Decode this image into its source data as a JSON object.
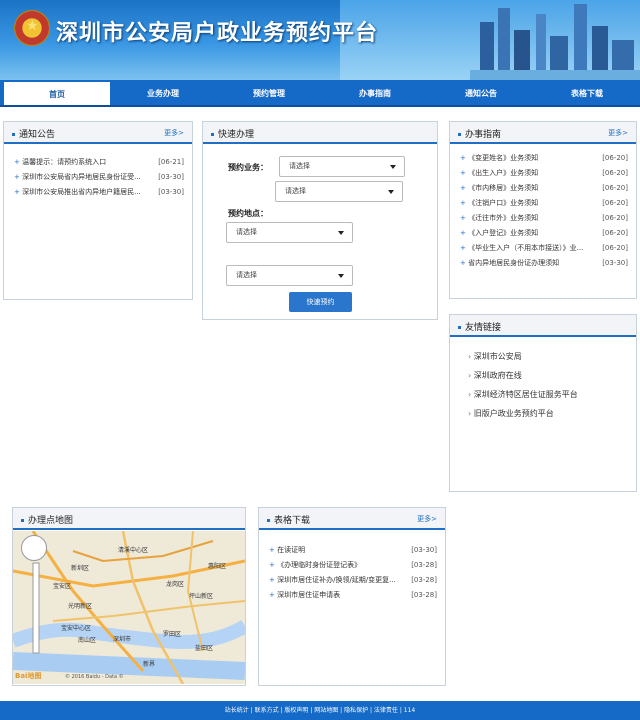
{
  "header": {
    "site_title": "深圳市公安局户政业务预约平台"
  },
  "nav": [
    "首页",
    "业务办理",
    "预约管理",
    "办事指南",
    "通知公告",
    "表格下载"
  ],
  "notice": {
    "title": "通知公告",
    "more": "更多>",
    "items": [
      {
        "text": "温馨提示：请预约系统入口",
        "date": "[06-21]"
      },
      {
        "text": "深圳市公安局省内异地居民身份证受...",
        "date": "[03-30]"
      },
      {
        "text": "深圳市公安局推出省内异地户籍居民...",
        "date": "[03-30]"
      }
    ]
  },
  "quick": {
    "title": "快速办理",
    "business_label": "预约业务：",
    "place_label": "预约地点：",
    "select_placeholder": "请选择",
    "submit": "快速预约"
  },
  "guide": {
    "title": "办事指南",
    "more": "更多>",
    "items": [
      {
        "text": "《变更姓名》业务须知",
        "date": "[06-20]"
      },
      {
        "text": "《出生入户》业务须知",
        "date": "[06-20]"
      },
      {
        "text": "《市内移居》业务须知",
        "date": "[06-20]"
      },
      {
        "text": "《注销户口》业务须知",
        "date": "[06-20]"
      },
      {
        "text": "《迁往市外》业务须知",
        "date": "[06-20]"
      },
      {
        "text": "《入户登记》业务须知",
        "date": "[06-20]"
      },
      {
        "text": "《毕业生入户（不用本市接送）》业...",
        "date": "[06-20]"
      },
      {
        "text": "省内异地居民身份证办理须知",
        "date": "[03-30]"
      }
    ]
  },
  "friends": {
    "title": "友情链接",
    "items": [
      "深圳市公安局",
      "深圳政府在线",
      "深圳经济特区居住证服务平台",
      "旧版户政业务预约平台"
    ]
  },
  "map": {
    "title": "办理点地图",
    "labels": [
      "清溪中心区",
      "新圳区",
      "宝安区",
      "龙岗区",
      "坪山新区",
      "光明新区",
      "宝安中心区",
      "南山区",
      "深圳市",
      "罗田区",
      "盐田区",
      "惠阳区",
      "新界"
    ],
    "baidu": "Bai地图",
    "copyright": "© 2016 Baidu - Data ©"
  },
  "download": {
    "title": "表格下载",
    "more": "更多>",
    "items": [
      {
        "text": "在读证明",
        "date": "[03-30]"
      },
      {
        "text": "《办理临时身份证登记表》",
        "date": "[03-28]"
      },
      {
        "text": "深圳市居住证补办/换领/延期/变更复...",
        "date": "[03-28]"
      },
      {
        "text": "深圳市居住证申请表",
        "date": "[03-28]"
      }
    ]
  },
  "footer": "站长统计 | 联系方式 | 版权声明 | 网站地图 | 隐私保护 | 法律责任 | 114"
}
